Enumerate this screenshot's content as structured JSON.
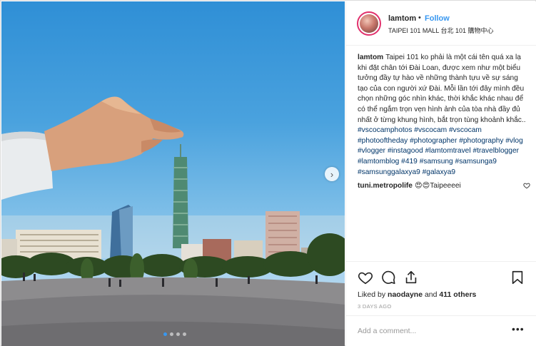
{
  "post": {
    "username": "lamtom",
    "separator": "•",
    "follow_label": "Follow",
    "location": "TAIPEI 101 MALL 台北 101 購物中心",
    "caption_text": "Taipei 101 ko phải là một cái tên quá xa lạ khi đặt chân tới Đài Loan, được xem như một biểu tưởng đầy tự hào về những thành tựu về sự sáng tạo của con người xứ Đài. Mỗi lần tới đây mình đều chọn những góc nhìn khác, thời khắc khác nhau để có thể ngắm trọn vẹn hình ảnh của tòa nhà đầy đủ nhất ở từng khung hình, bắt trọn tùng khoảnh khắc..",
    "hashtags": [
      "#vscocamphotos",
      "#vscocam",
      "#vscocam",
      "#photooftheday",
      "#photographer",
      "#photography",
      "#vlog",
      "#vlogger",
      "#instagood",
      "#lamtomtravel",
      "#travelblogger",
      "#lamtomblog",
      "#419",
      "#samsung",
      "#samsunga9",
      "#samsunggalaxya9",
      "#galaxya9"
    ],
    "comment": {
      "username": "tuni.metropolife",
      "text": "😍😍Taipeeeei"
    },
    "likes_prefix": "Liked by",
    "likes_user": "naodayne",
    "likes_and": "and",
    "likes_others": "411 others",
    "date": "3 DAYS AGO",
    "add_comment_placeholder": "Add a comment...",
    "more_label": "•••",
    "carousel": {
      "total": 4,
      "active": 0
    },
    "next_glyph": "›"
  },
  "colors": {
    "accent": "#3897f0",
    "hashtag": "#003569",
    "text": "#262626",
    "muted": "#999999"
  },
  "icons": [
    "heart-icon",
    "comment-icon",
    "share-icon",
    "bookmark-icon",
    "next-arrow-icon",
    "more-icon"
  ]
}
